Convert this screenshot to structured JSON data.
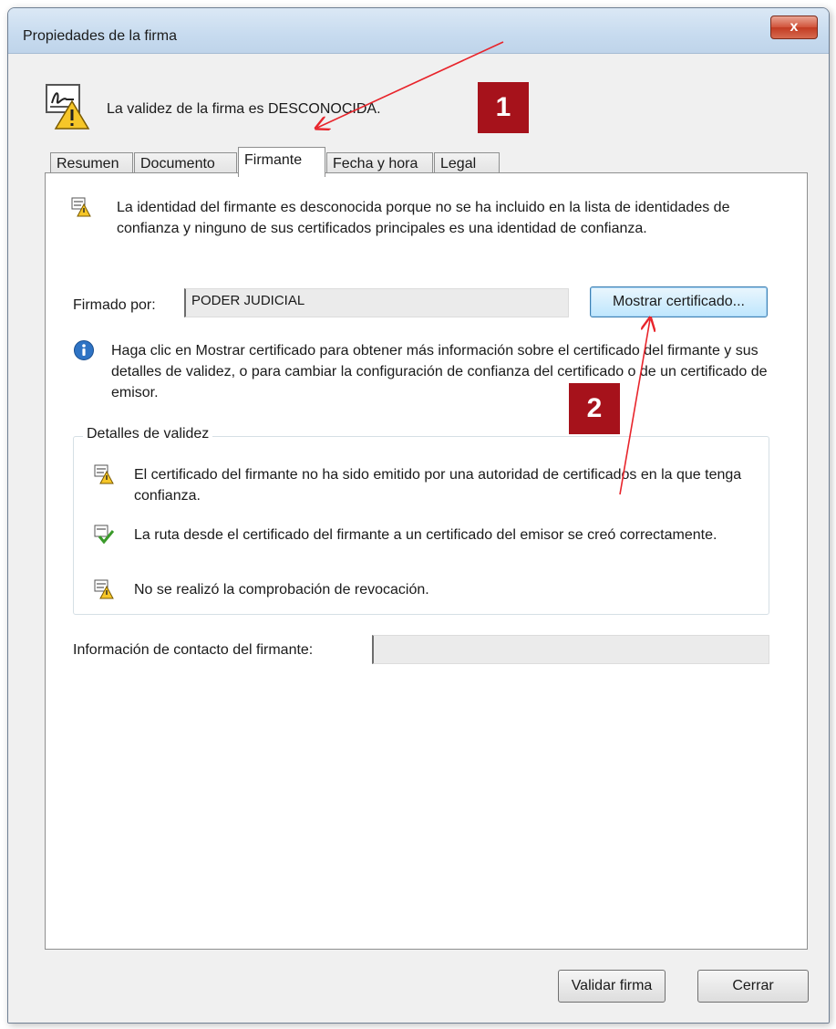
{
  "window": {
    "title": "Propiedades de la firma",
    "close_glyph": "x"
  },
  "status": {
    "text": "La validez de la firma es DESCONOCIDA.",
    "icon": "signature-warning-icon"
  },
  "tabs": [
    {
      "label": "Resumen"
    },
    {
      "label": "Documento"
    },
    {
      "label": "Firmante",
      "active": true
    },
    {
      "label": "Fecha y hora"
    },
    {
      "label": "Legal"
    }
  ],
  "signer_tab": {
    "identity_text": "La identidad del firmante es desconocida porque no se ha incluido en la lista de identidades de confianza y ninguno de sus certificados principales es una identidad de confianza.",
    "signed_by_label": "Firmado por:",
    "signed_by_value": "PODER JUDICIAL",
    "show_cert_button": "Mostrar certificado...",
    "info_text": "Haga clic en Mostrar certificado para obtener más información sobre el certificado del firmante y sus detalles de validez, o para cambiar la configuración de confianza del certificado o de un certificado de emisor.",
    "validity_group_title": "Detalles de validez",
    "validity_items": [
      {
        "text": "El certificado del firmante no ha sido emitido por una autoridad de certificados en la que tenga confianza.",
        "icon": "warning-cert-icon"
      },
      {
        "text": "La ruta desde el certificado del firmante a un certificado del emisor se creó correctamente.",
        "icon": "valid-check-icon"
      },
      {
        "text": "No se realizó la comprobación de revocación.",
        "icon": "warning-cert-icon"
      }
    ],
    "contact_label": "Información de contacto del firmante:",
    "contact_value": ""
  },
  "footer": {
    "validate_button": "Validar firma",
    "close_button": "Cerrar"
  },
  "annotations": [
    {
      "label": "1"
    },
    {
      "label": "2"
    }
  ],
  "colors": {
    "badge": "#a6121b",
    "arrow": "#e8242b",
    "titlebar": "#c7dbef"
  }
}
